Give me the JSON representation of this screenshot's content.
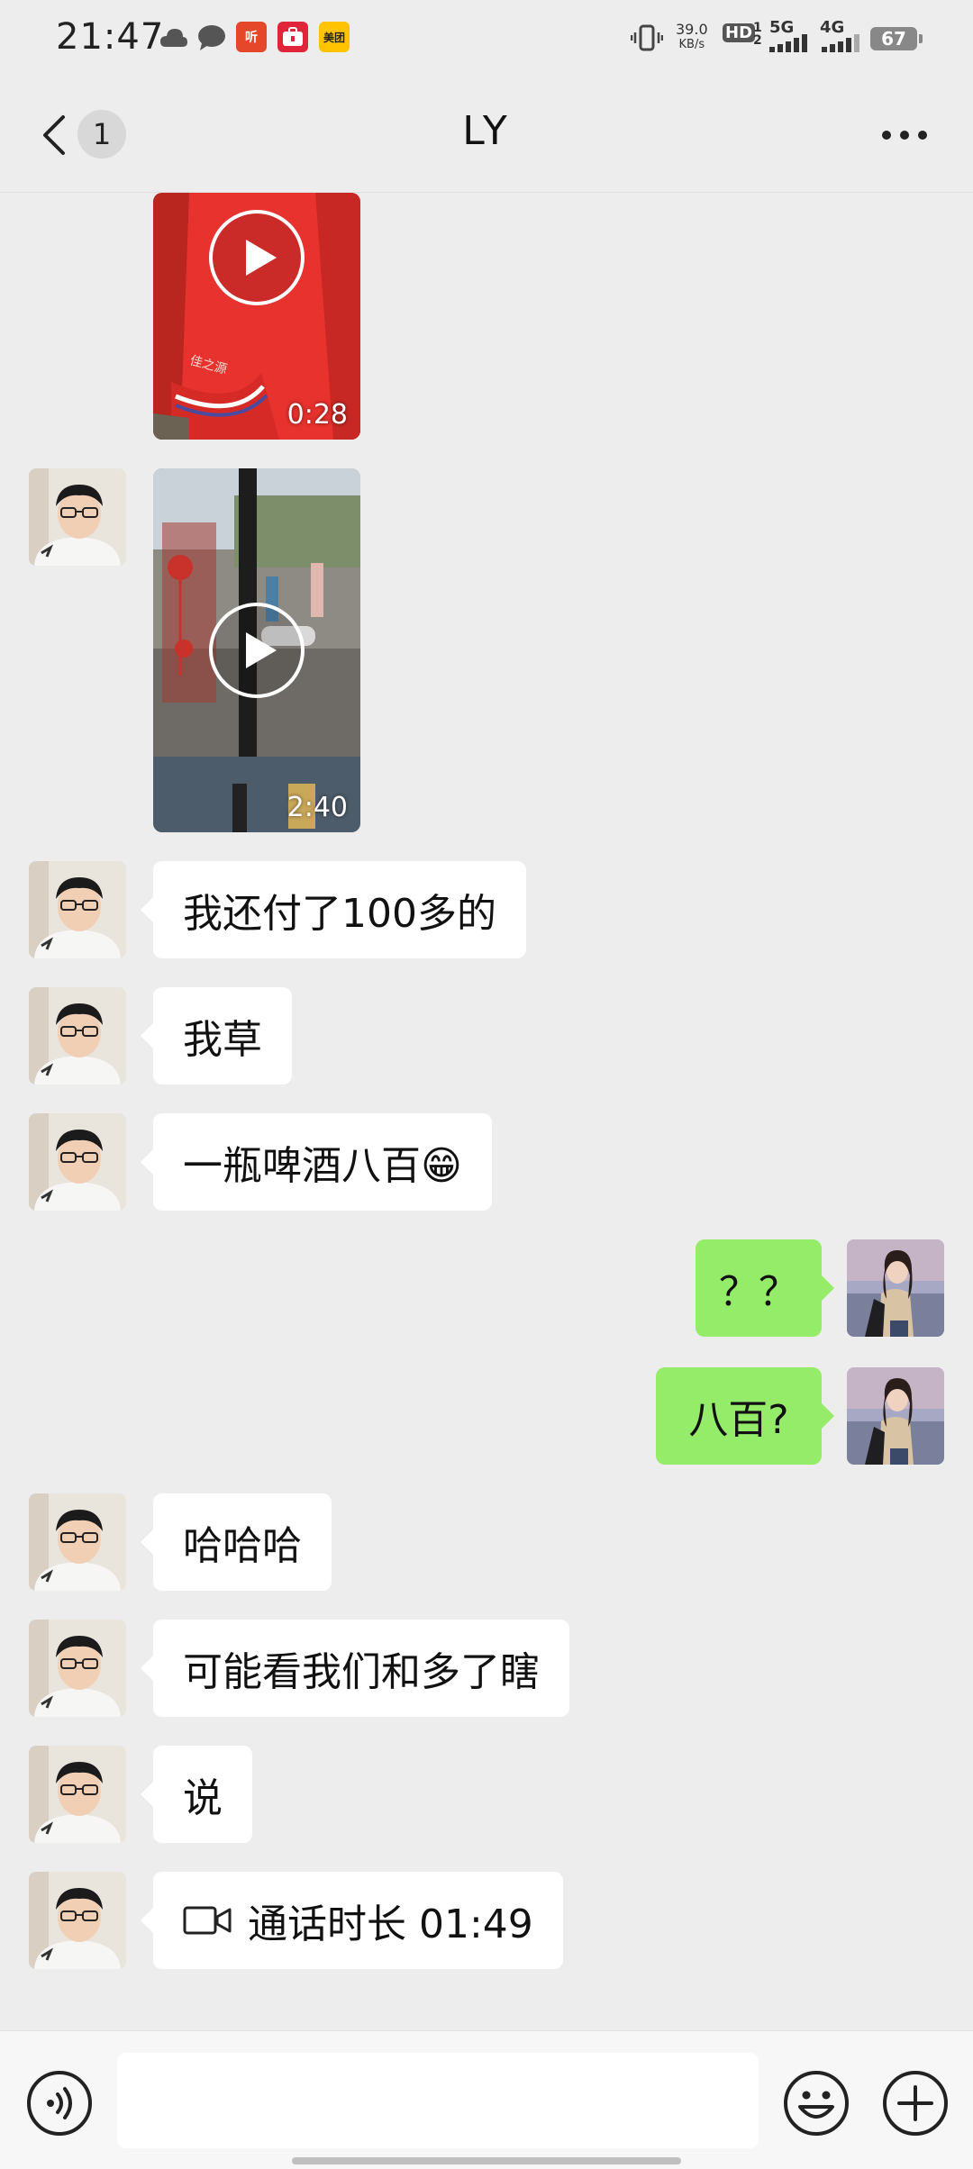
{
  "status_bar": {
    "time": "21:47",
    "app_icons": [
      "cloud-icon",
      "chat-bubble-icon",
      "ting-app-icon",
      "redbook-app-icon",
      "meituan-app-icon"
    ],
    "app_badges": {
      "ting": "听",
      "meituan": "美团"
    },
    "net_speed_value": "39.0",
    "net_speed_unit": "KB/s",
    "hd_label": "HD",
    "sim1_label": "5G",
    "sim2_label": "4G",
    "battery": "67"
  },
  "header": {
    "unread_count": "1",
    "title": "LY"
  },
  "messages": [
    {
      "type": "video",
      "side": "in",
      "duration": "0:28"
    },
    {
      "type": "video",
      "side": "in",
      "duration": "2:40"
    },
    {
      "type": "text",
      "side": "in",
      "text": "我还付了100多的"
    },
    {
      "type": "text",
      "side": "in",
      "text": "我草"
    },
    {
      "type": "text",
      "side": "in",
      "text": "一瓶啤酒八百😁"
    },
    {
      "type": "text",
      "side": "out",
      "text": "？？"
    },
    {
      "type": "text",
      "side": "out",
      "text": "八百?"
    },
    {
      "type": "text",
      "side": "in",
      "text": "哈哈哈"
    },
    {
      "type": "text",
      "side": "in",
      "text": "可能看我们和多了瞎"
    },
    {
      "type": "text",
      "side": "in",
      "text": "说"
    },
    {
      "type": "call",
      "side": "in",
      "text": "通话时长 01:49",
      "icon": "video-camera-icon"
    }
  ],
  "input_bar": {
    "text_value": "",
    "voice_icon": "voice-icon",
    "emoji_icon": "emoji-icon",
    "plus_icon": "plus-icon"
  },
  "colors": {
    "background": "#ededed",
    "outgoing_bubble": "#95ec69",
    "incoming_bubble": "#ffffff",
    "video1_shirt": "#e8322e"
  }
}
